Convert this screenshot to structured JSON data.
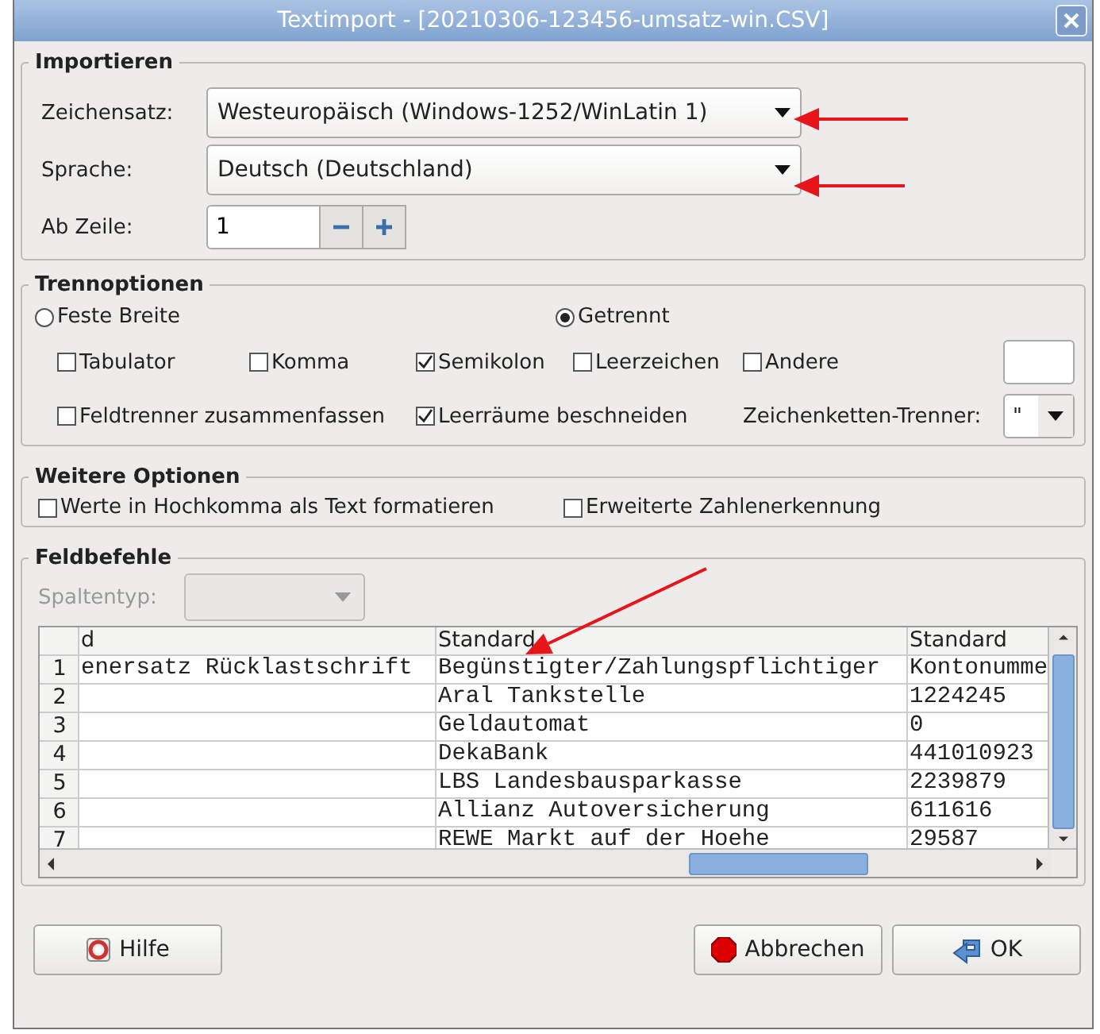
{
  "window": {
    "title": "Textimport - [20210306-123456-umsatz-win.CSV]"
  },
  "import": {
    "title": "Importieren",
    "charset": {
      "label": "Zeichensatz:",
      "value": "Westeuropäisch (Windows-1252/WinLatin 1)"
    },
    "language": {
      "label": "Sprache:",
      "value": "Deutsch (Deutschland)"
    },
    "start_row": {
      "label": "Ab Zeile:",
      "value": "1"
    }
  },
  "separator_options": {
    "title": "Trennoptionen",
    "modes": [
      {
        "label": "Feste Breite",
        "selected": false
      },
      {
        "label": "Getrennt",
        "selected": true
      }
    ],
    "separators": [
      {
        "label": "Tabulator",
        "checked": false
      },
      {
        "label": "Komma",
        "checked": false
      },
      {
        "label": "Semikolon",
        "checked": true
      },
      {
        "label": "Leerzeichen",
        "checked": false
      },
      {
        "label": "Andere",
        "checked": false
      }
    ],
    "options": [
      {
        "label": "Feldtrenner zusammenfassen",
        "checked": false
      },
      {
        "label": "Leerräume beschneiden",
        "checked": true
      }
    ],
    "text_delimiter": {
      "label": "Zeichenketten-Trenner:",
      "value": "\""
    }
  },
  "other_options": {
    "title": "Weitere Optionen",
    "options": [
      {
        "label": "Werte in Hochkomma als Text formatieren",
        "checked": false
      },
      {
        "label": "Erweiterte Zahlenerkennung",
        "checked": false
      }
    ]
  },
  "fields": {
    "title": "Feldbefehle",
    "column_type": {
      "label": "Spaltentyp:",
      "disabled": true
    },
    "table": {
      "columns": [
        "d",
        "Standard",
        "Standard"
      ],
      "rows": [
        {
          "number": "1",
          "cells": [
            "enersatz Rücklastschrift",
            "Begünstigter/Zahlungspflichtiger",
            "Kontonumme"
          ]
        },
        {
          "number": "2",
          "cells": [
            "",
            "Aral Tankstelle",
            "1224245"
          ]
        },
        {
          "number": "3",
          "cells": [
            "",
            "Geldautomat",
            "0"
          ]
        },
        {
          "number": "4",
          "cells": [
            "",
            "DekaBank",
            "441010923"
          ]
        },
        {
          "number": "5",
          "cells": [
            "",
            "LBS Landesbausparkasse",
            "2239879"
          ]
        },
        {
          "number": "6",
          "cells": [
            "",
            "Allianz Autoversicherung",
            "611616"
          ]
        },
        {
          "number": "7",
          "cells": [
            "",
            "REWE Markt auf der Hoehe",
            "29587"
          ]
        }
      ]
    }
  },
  "buttons": [
    {
      "label": "Hilfe",
      "kind": "help"
    },
    {
      "label": "Abbrechen",
      "kind": "cancel"
    },
    {
      "label": "OK",
      "kind": "ok"
    }
  ]
}
